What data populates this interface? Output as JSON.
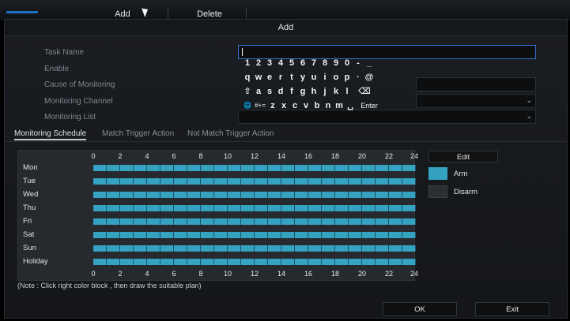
{
  "topbar": {
    "add_label": "Add",
    "delete_label": "Delete"
  },
  "dialog": {
    "title": "Add"
  },
  "form": {
    "task_name_label": "Task Name",
    "enable_label": "Enable",
    "cause_label": "Cause of Monitoring",
    "channel_label": "Monitoring Channel",
    "list_label": "Monitoring List",
    "task_name_value": ""
  },
  "keyboard": {
    "row1": [
      "1",
      "2",
      "3",
      "4",
      "5",
      "6",
      "7",
      "8",
      "9",
      "0",
      "-",
      "_"
    ],
    "row2": [
      "q",
      "w",
      "e",
      "r",
      "t",
      "y",
      "u",
      "i",
      "o",
      "p",
      "·",
      "@"
    ],
    "row3": [
      "⇧",
      "a",
      "s",
      "d",
      "f",
      "g",
      "h",
      "j",
      "k",
      "l",
      "⌫"
    ],
    "row4": [
      "🌐",
      "#+=",
      "z",
      "x",
      "c",
      "v",
      "b",
      "n",
      "m",
      "␣",
      "Enter"
    ]
  },
  "tabs": [
    "Monitoring Schedule",
    "Match Trigger Action",
    "Not Match Trigger Action"
  ],
  "schedule": {
    "hours": [
      "0",
      "2",
      "4",
      "6",
      "8",
      "10",
      "12",
      "14",
      "16",
      "18",
      "20",
      "22",
      "24"
    ],
    "days": [
      "Mon",
      "Tue",
      "Wed",
      "Thu",
      "Fri",
      "Sat",
      "Sun",
      "Holiday"
    ],
    "note": "(Note : Click right color block , then draw the suitable plan)"
  },
  "legend": {
    "edit_label": "Edit",
    "arm_label": "Arm",
    "disarm_label": "Disarm",
    "arm_color": "#36a2c2",
    "disarm_color": "#2b2f33"
  },
  "footer": {
    "ok_label": "OK",
    "exit_label": "Exit"
  }
}
